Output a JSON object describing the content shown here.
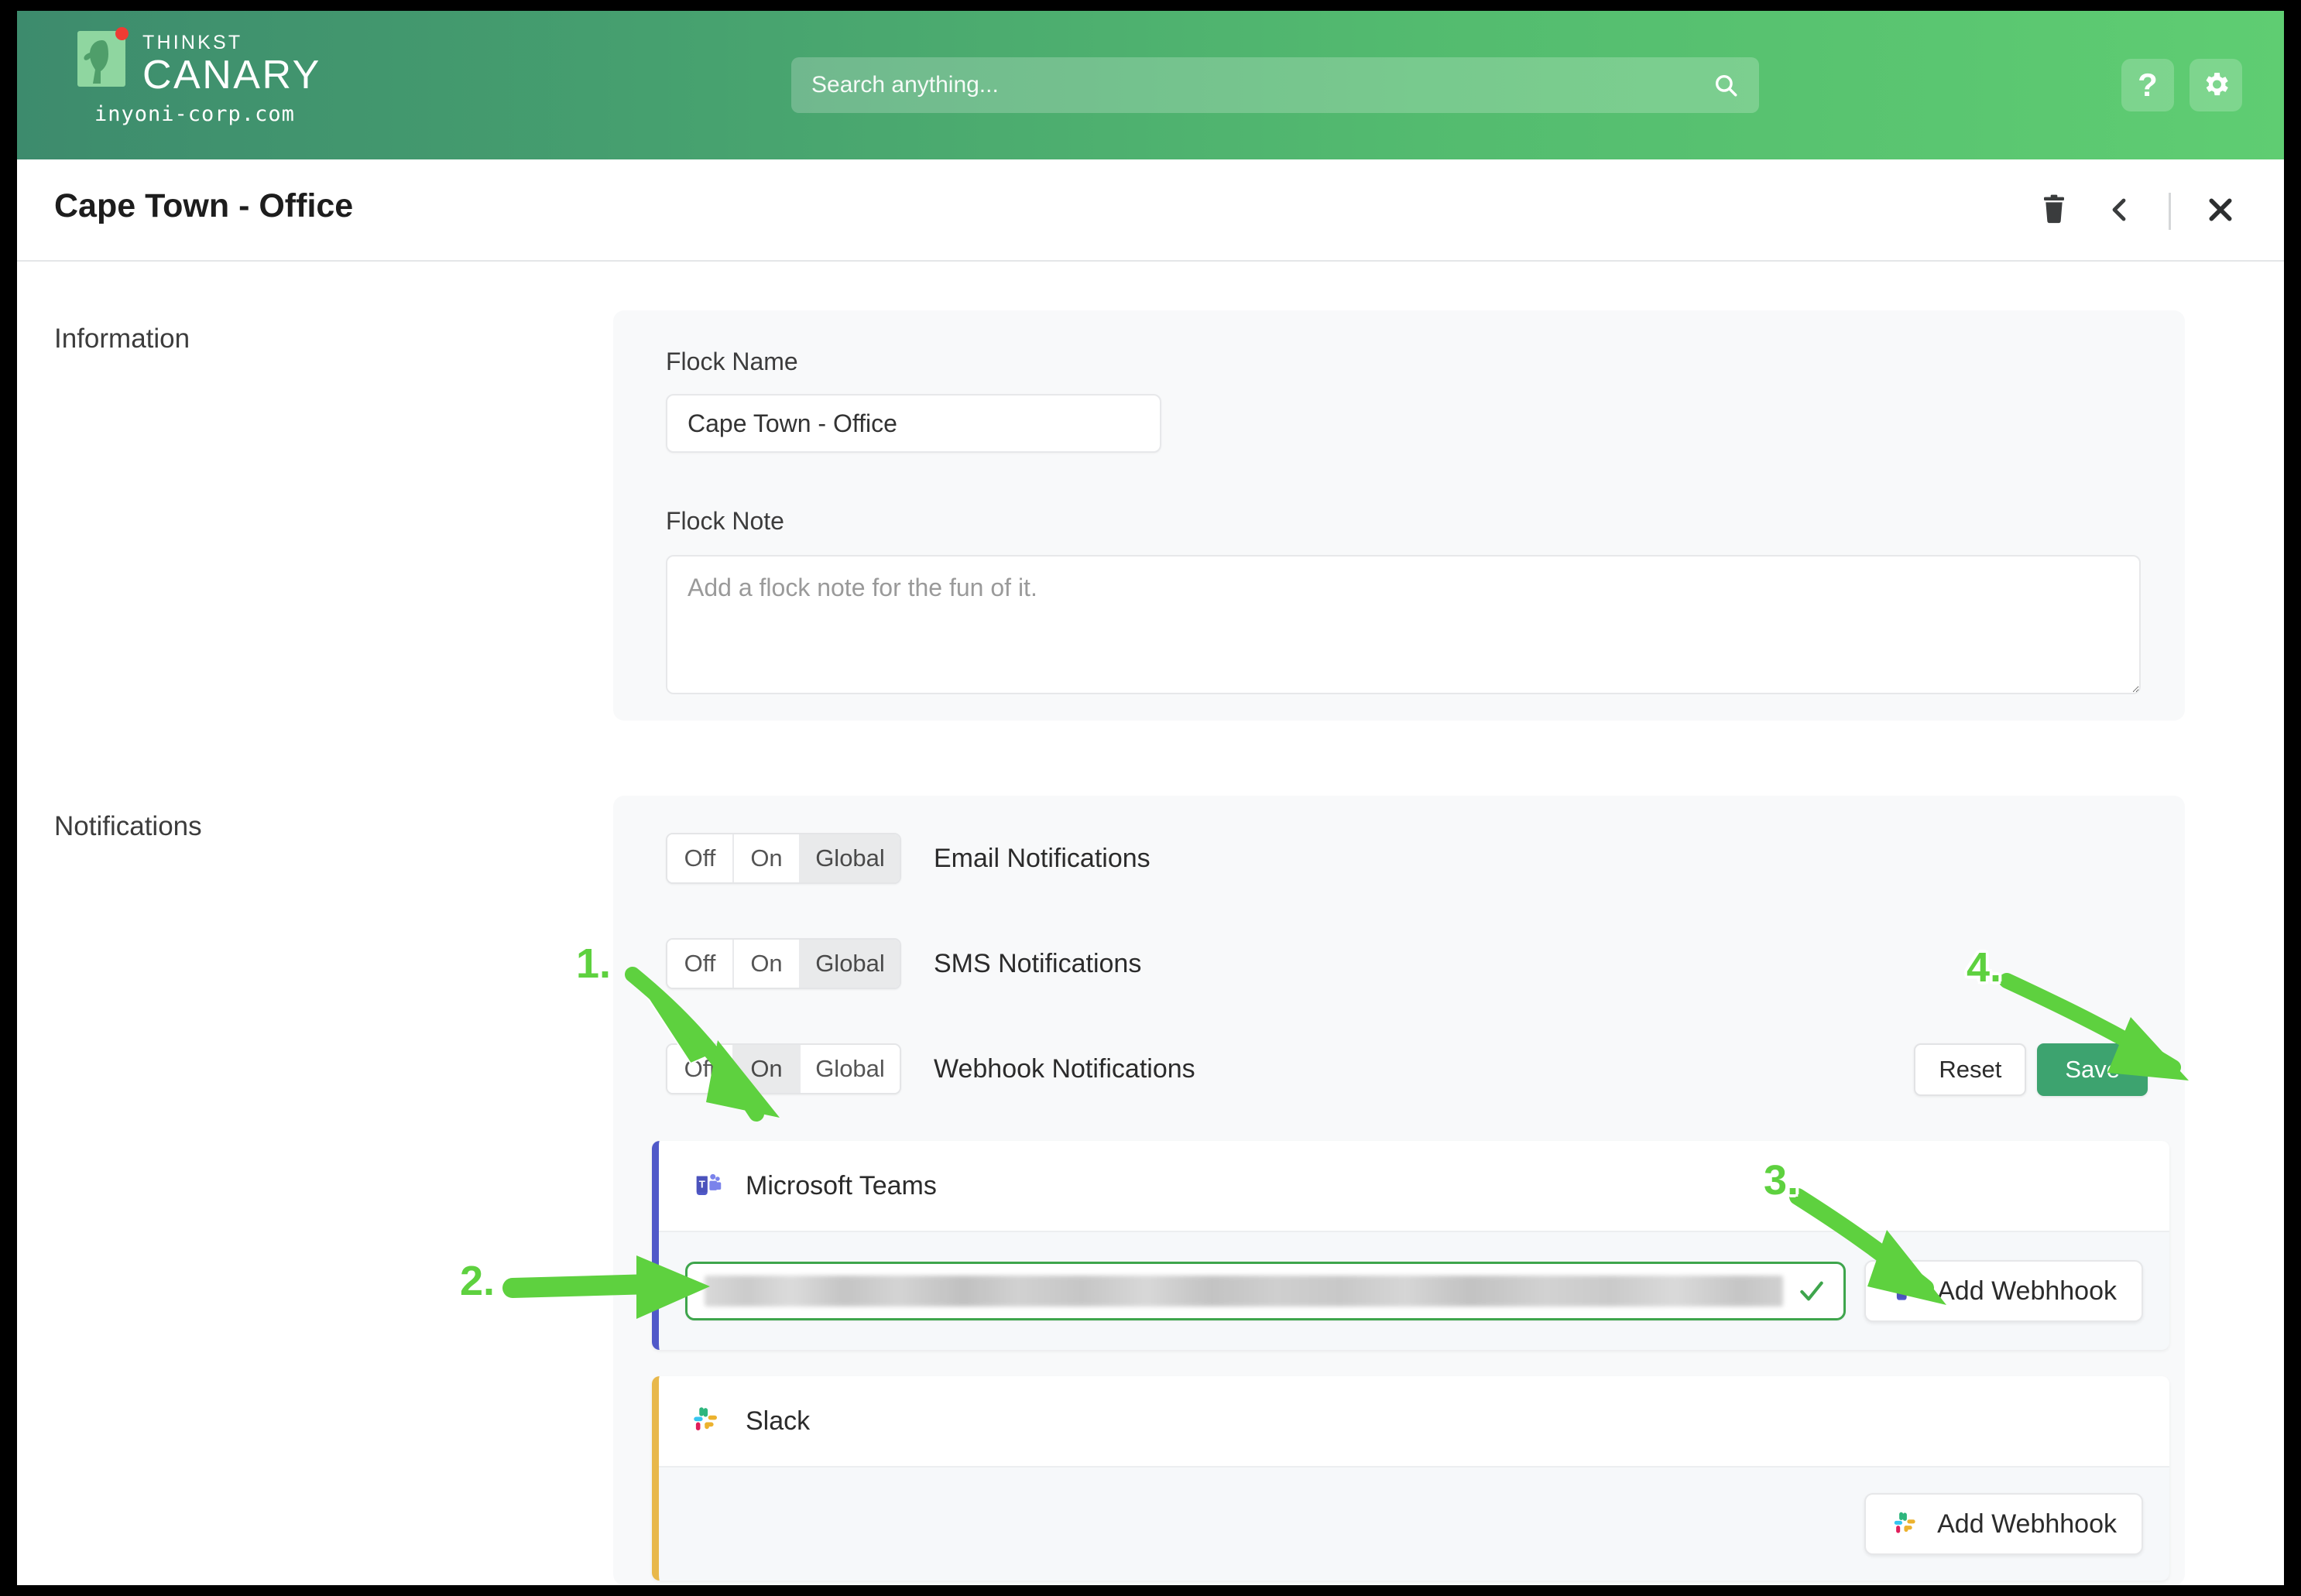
{
  "appbar": {
    "brand_top": "THINKST",
    "brand_main": "CANARY",
    "domain": "inyoni-corp.com",
    "search_placeholder": "Search anything...",
    "search_value": "",
    "help_glyph": "?",
    "icons": {
      "search": "search-icon",
      "help": "help-icon",
      "gear": "gear-icon"
    },
    "colors": {
      "gradient_start": "#3d8b6d",
      "gradient_end": "#5fcd72"
    }
  },
  "titlebar": {
    "title": "Cape Town - Office",
    "actions": [
      {
        "name": "delete-flock",
        "icon": "trash-icon"
      },
      {
        "name": "back",
        "icon": "chevron-left-icon"
      },
      {
        "name": "close",
        "icon": "close-icon"
      }
    ]
  },
  "sections": {
    "information": {
      "label": "Information",
      "flock_name_label": "Flock Name",
      "flock_name_value": "Cape Town - Office",
      "flock_note_label": "Flock Note",
      "flock_note_value": "",
      "flock_note_placeholder": "Add a flock note for the fun of it."
    },
    "notifications": {
      "label": "Notifications",
      "segment_options": [
        "Off",
        "On",
        "Global"
      ],
      "rows": [
        {
          "name": "email-notifications",
          "caption": "Email Notifications",
          "selected": "Global"
        },
        {
          "name": "sms-notifications",
          "caption": "SMS Notifications",
          "selected": "Global"
        },
        {
          "name": "webhook-notifications",
          "caption": "Webhook Notifications",
          "selected": "On"
        }
      ],
      "reset_label": "Reset",
      "save_label": "Save",
      "save_color": "#3da36f"
    }
  },
  "providers": [
    {
      "name": "microsoft-teams",
      "title": "Microsoft Teams",
      "accent": "#5059c9",
      "icon": "microsoft-teams-icon",
      "webhook_value": "",
      "webhook_status": "valid",
      "add_webhook_label": "Add Webhhook"
    },
    {
      "name": "slack",
      "title": "Slack",
      "accent": "#e8b84b",
      "icon": "slack-icon",
      "add_webhook_label": "Add Webhhook"
    }
  ],
  "annotations": {
    "color": "#5ed13f",
    "steps": [
      {
        "id": "1",
        "label": "1.",
        "target": "webhook-notifications-on-segment"
      },
      {
        "id": "2",
        "label": "2.",
        "target": "teams-webhook-input"
      },
      {
        "id": "3",
        "label": "3.",
        "target": "teams-add-webhook-button"
      },
      {
        "id": "4",
        "label": "4.",
        "target": "save-button"
      }
    ]
  }
}
